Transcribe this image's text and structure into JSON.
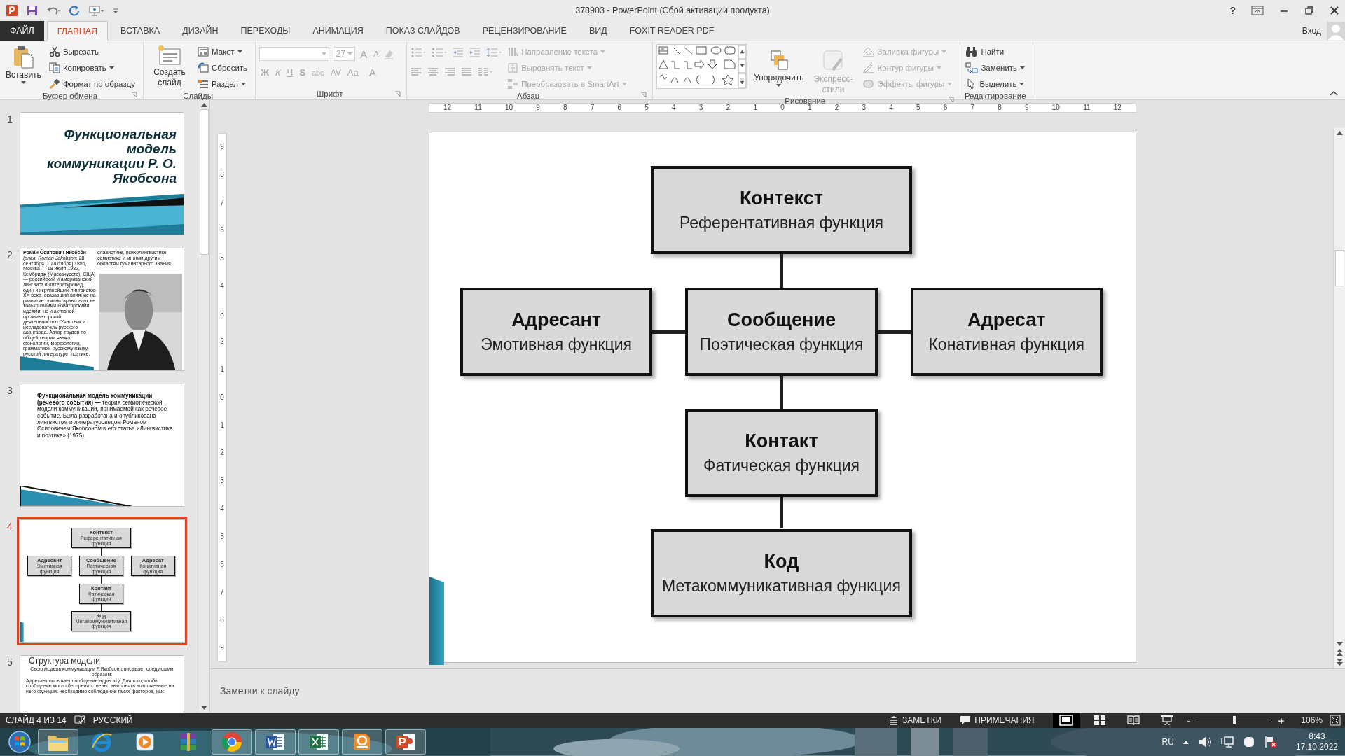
{
  "window": {
    "title": "378903 - PowerPoint (Сбой активации продукта)",
    "help": "?",
    "account": "Вход"
  },
  "ribbon_tabs": [
    {
      "label": "ФАЙЛ",
      "kind": "file",
      "selected": false
    },
    {
      "label": "ГЛАВНАЯ",
      "kind": "tab",
      "selected": true
    },
    {
      "label": "ВСТАВКА",
      "kind": "tab",
      "selected": false
    },
    {
      "label": "ДИЗАЙН",
      "kind": "tab",
      "selected": false
    },
    {
      "label": "ПЕРЕХОДЫ",
      "kind": "tab",
      "selected": false
    },
    {
      "label": "АНИМАЦИЯ",
      "kind": "tab",
      "selected": false
    },
    {
      "label": "ПОКАЗ СЛАЙДОВ",
      "kind": "tab",
      "selected": false
    },
    {
      "label": "РЕЦЕНЗИРОВАНИЕ",
      "kind": "tab",
      "selected": false
    },
    {
      "label": "ВИД",
      "kind": "tab",
      "selected": false
    },
    {
      "label": "FOXIT READER PDF",
      "kind": "tab",
      "selected": false
    }
  ],
  "ribbon": {
    "clipboard": {
      "label": "Буфер обмена",
      "paste": "Вставить",
      "items": [
        {
          "label": "Вырезать",
          "dropdown": false
        },
        {
          "label": "Копировать",
          "dropdown": true
        },
        {
          "label": "Формат по образцу",
          "dropdown": false
        }
      ]
    },
    "slides": {
      "label": "Слайды",
      "new_slide": "Создать слайд",
      "items": [
        {
          "label": "Макет",
          "dropdown": true
        },
        {
          "label": "Сбросить",
          "dropdown": false
        },
        {
          "label": "Раздел",
          "dropdown": true
        }
      ]
    },
    "font": {
      "label": "Шрифт",
      "font_size": "27",
      "size_buttons": [
        "A",
        "A"
      ],
      "format_buttons": [
        "Ж",
        "К",
        "Ч",
        "S",
        "abc",
        "AV",
        "Aa",
        "A"
      ]
    },
    "paragraph": {
      "label": "Абзац",
      "items": [
        {
          "label": "Направление текста",
          "disabled": true
        },
        {
          "label": "Выровнять текст",
          "disabled": true
        },
        {
          "label": "Преобразовать в SmartArt",
          "disabled": true
        }
      ]
    },
    "drawing": {
      "label": "Рисование",
      "arrange": "Упорядочить",
      "quick_styles": {
        "label": "Экспресс-стили",
        "disabled": true
      },
      "items": [
        {
          "label": "Заливка фигуры",
          "disabled": true
        },
        {
          "label": "Контур фигуры",
          "disabled": true
        },
        {
          "label": "Эффекты фигуры",
          "disabled": true
        }
      ]
    },
    "editing": {
      "label": "Редактирование",
      "items": [
        {
          "label": "Найти",
          "dropdown": false
        },
        {
          "label": "Заменить",
          "dropdown": true
        },
        {
          "label": "Выделить",
          "dropdown": true
        }
      ]
    }
  },
  "thumbnails": [
    {
      "number": "1",
      "kind": "title",
      "selected": false,
      "title": "Функциональная модель коммуникации Р. О. Якобсона"
    },
    {
      "number": "2",
      "kind": "bio",
      "selected": false,
      "left_text": "**Рома́н О́сипович Якобсо́н** (*англ. Roman Jakobson*; 28 сентября [10 октября] 1896, Москва — 18 июля 1982, Кембридж (Массачусетс), США) — российский и американский лингвист и литературовед, один из крупнейших лингвистов XX века, оказавший влияние на развитие гуманитарных наук не только своими новаторскими идеями, но и активной организаторской деятельностью. Участник и исследователь русского авангарда. Автор трудов по общей теории языка, фонологии, морфологии, грамматике, русскому языку, русской литературе, поэтике,",
      "right_text": "славистике, психолингвистике, семиотике и многим другим областям гуманитарного знания."
    },
    {
      "number": "3",
      "kind": "text",
      "selected": false,
      "bullet": "**Функциона́льная моде́ль коммуника́ции (речево́го собы́тия) —** теория семиотической модели коммуникации, понимаемой как речевое событие. Была разработана и опубликована лингвистом и литературоведом Романом Осиповичем Якобсоном в его статье «Лингвистика и поэтика» (1975)."
    },
    {
      "number": "4",
      "kind": "diagram",
      "selected": true,
      "nodes": [
        {
          "title": "Контекст",
          "subtitle": "Референтативная функция"
        },
        {
          "title": "Адресант",
          "subtitle": "Эмотивная функция"
        },
        {
          "title": "Сообщение",
          "subtitle": "Поэтическая функция"
        },
        {
          "title": "Адресат",
          "subtitle": "Конативная функция"
        },
        {
          "title": "Контакт",
          "subtitle": "Фатическая функция"
        },
        {
          "title": "Код",
          "subtitle": "Метакоммуникативная функция"
        }
      ]
    },
    {
      "number": "5",
      "kind": "heading",
      "selected": false,
      "title": "Структура модели",
      "paragraphs": [
        "Свою модель коммуникации Р.Якобсон описывает следующим образом:",
        "Адресант посылает сообщение адресату. Для того, чтобы сообщение могло беспрепятственно выполнять возложенные на него функции, необходимо соблюдение таких факторов, как:"
      ]
    }
  ],
  "rulers": {
    "horizontal": [
      "12",
      "11",
      "10",
      "9",
      "8",
      "7",
      "6",
      "5",
      "4",
      "3",
      "2",
      "1",
      "0",
      "1",
      "2",
      "3",
      "4",
      "5",
      "6",
      "7",
      "8",
      "9",
      "10",
      "11",
      "12"
    ],
    "vertical": [
      "9",
      "8",
      "7",
      "6",
      "5",
      "4",
      "3",
      "2",
      "1",
      "0",
      "1",
      "2",
      "3",
      "4",
      "5",
      "6",
      "7",
      "8",
      "9"
    ]
  },
  "slide": {
    "nodes": [
      {
        "title": "Контекст",
        "subtitle": "Референтативная функция"
      },
      {
        "title": "Адресант",
        "subtitle": "Эмотивная функция"
      },
      {
        "title": "Сообщение",
        "subtitle": "Поэтическая функция"
      },
      {
        "title": "Адресат",
        "subtitle": "Конативная функция"
      },
      {
        "title": "Контакт",
        "subtitle": "Фатическая функция"
      },
      {
        "title": "Код",
        "subtitle": "Метакоммуникативная функция"
      }
    ]
  },
  "notes": {
    "placeholder": "Заметки к слайду"
  },
  "status_bar": {
    "slide_info": "СЛАЙД 4 ИЗ 14",
    "language": "РУССКИЙ",
    "notes": "ЗАМЕТКИ",
    "comments": "ПРИМЕЧАНИЯ",
    "views": [
      {
        "selected": true
      },
      {
        "selected": false
      },
      {
        "selected": false
      },
      {
        "selected": false
      }
    ],
    "zoom": {
      "minus": "-",
      "plus": "+",
      "level": 0.5,
      "reading": "106%"
    }
  },
  "taskbar": {
    "apps": [
      {
        "running": true
      },
      {
        "running": false
      },
      {
        "running": false
      },
      {
        "running": false
      },
      {
        "running": true
      },
      {
        "running": true
      },
      {
        "running": true
      },
      {
        "running": true
      },
      {
        "running": true
      }
    ],
    "language": "RU",
    "time": "8:43",
    "date": "17.10.2022"
  }
}
